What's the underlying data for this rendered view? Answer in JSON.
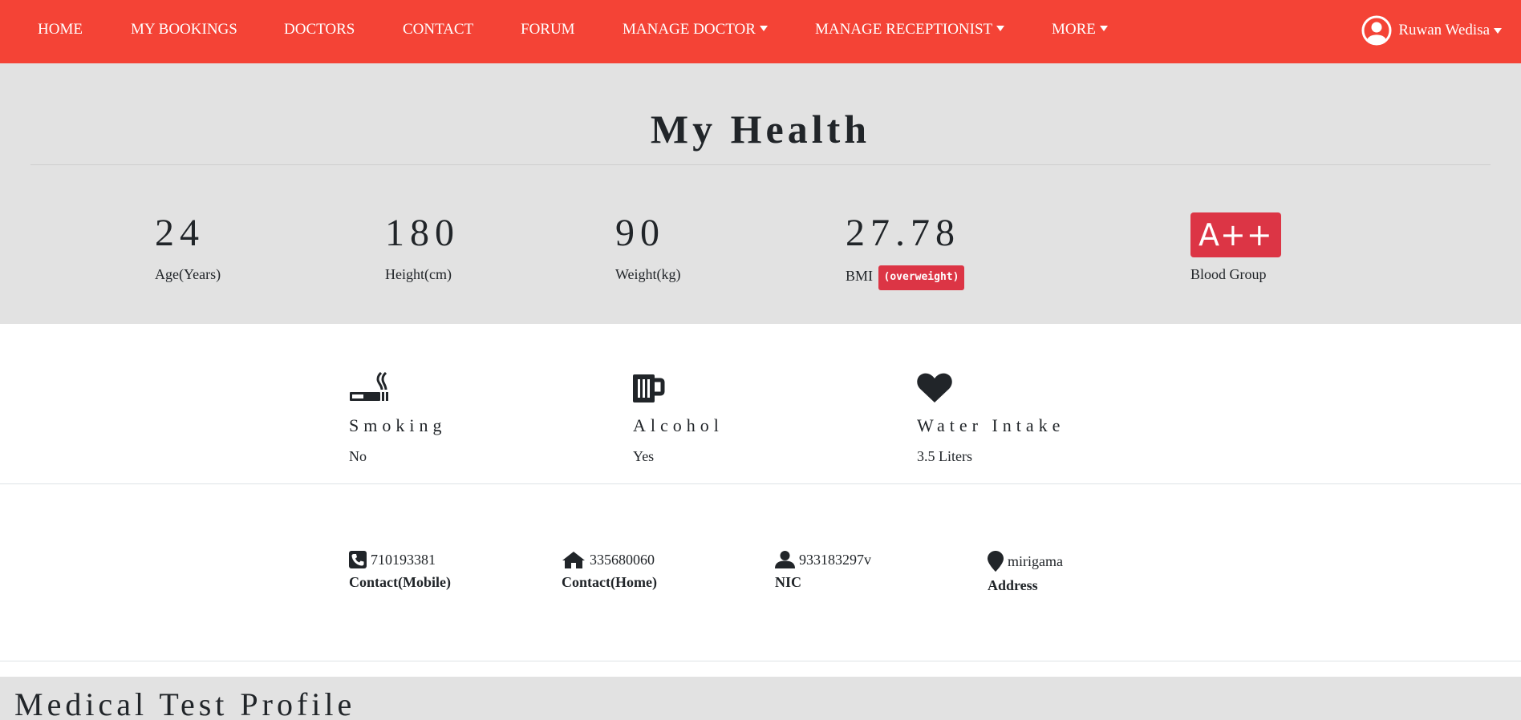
{
  "nav": {
    "items": [
      {
        "label": "HOME"
      },
      {
        "label": "MY BOOKINGS"
      },
      {
        "label": "DOCTORS"
      },
      {
        "label": "CONTACT"
      },
      {
        "label": "FORUM"
      },
      {
        "label": "MANAGE DOCTOR"
      },
      {
        "label": "MANAGE RECEPTIONIST"
      },
      {
        "label": "MORE"
      }
    ],
    "user": {
      "name": "Ruwan Wedisa",
      "icon": "user-circle-icon"
    }
  },
  "health": {
    "title": "My Health",
    "stats": [
      {
        "value": "24",
        "label": "Age(Years)"
      },
      {
        "value": "180",
        "label": "Height(cm)"
      },
      {
        "value": "90",
        "label": "Weight(kg)"
      },
      {
        "value": "27.78",
        "label": "BMI",
        "badge": "(overweight)"
      },
      {
        "value": "A++",
        "label": "Blood Group"
      }
    ]
  },
  "habits": [
    {
      "icon": "smoking-icon",
      "title": "Smoking",
      "value": "No"
    },
    {
      "icon": "beer-mug-icon",
      "title": "Alcohol",
      "value": "Yes"
    },
    {
      "icon": "heart-icon",
      "title": "Water Intake",
      "value": "3.5 Liters"
    }
  ],
  "contact": [
    {
      "icon": "phone-icon",
      "value": "710193381",
      "label": "Contact(Mobile)"
    },
    {
      "icon": "home-icon",
      "value": "335680060",
      "label": "Contact(Home)"
    },
    {
      "icon": "user-icon",
      "value": "933183297v",
      "label": "NIC"
    },
    {
      "icon": "map-marker-icon",
      "value": "mirigama",
      "label": "Address"
    }
  ],
  "medical": {
    "title": "Medical Test Profile"
  },
  "colors": {
    "primary": "#f44336",
    "danger": "#dc3545",
    "section_bg": "#e2e2e2",
    "text": "#212529"
  }
}
